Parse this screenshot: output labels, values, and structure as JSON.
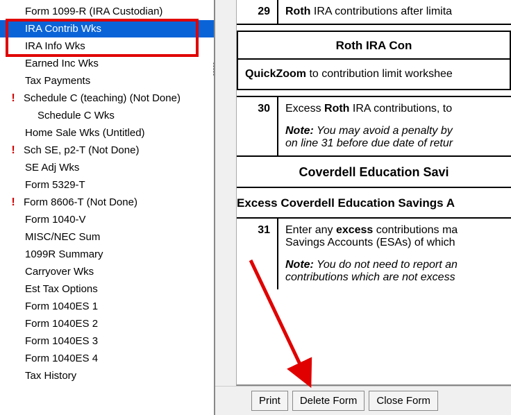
{
  "sidebar": {
    "items": [
      {
        "label": "Form 1099-R (IRA Custodian)",
        "indent": 1,
        "flag": false,
        "selected": false
      },
      {
        "label": "IRA Contrib Wks",
        "indent": 1,
        "flag": false,
        "selected": true
      },
      {
        "label": "IRA Info Wks",
        "indent": 1,
        "flag": false,
        "selected": false
      },
      {
        "label": "Earned Inc Wks",
        "indent": 1,
        "flag": false,
        "selected": false
      },
      {
        "label": "Tax Payments",
        "indent": 1,
        "flag": false,
        "selected": false
      },
      {
        "label": "Schedule C (teaching) (Not Done)",
        "indent": 1,
        "flag": true,
        "selected": false
      },
      {
        "label": "Schedule C Wks",
        "indent": 2,
        "flag": false,
        "selected": false
      },
      {
        "label": "Home Sale Wks (Untitled)",
        "indent": 1,
        "flag": false,
        "selected": false
      },
      {
        "label": "Sch SE, p2-T (Not Done)",
        "indent": 1,
        "flag": true,
        "selected": false
      },
      {
        "label": "SE Adj Wks",
        "indent": 1,
        "flag": false,
        "selected": false
      },
      {
        "label": "Form 5329-T",
        "indent": 1,
        "flag": false,
        "selected": false
      },
      {
        "label": "Form 8606-T (Not Done)",
        "indent": 1,
        "flag": true,
        "selected": false
      },
      {
        "label": "Form 1040-V",
        "indent": 1,
        "flag": false,
        "selected": false
      },
      {
        "label": "MISC/NEC Sum",
        "indent": 1,
        "flag": false,
        "selected": false
      },
      {
        "label": "1099R Summary",
        "indent": 1,
        "flag": false,
        "selected": false
      },
      {
        "label": "Carryover Wks",
        "indent": 1,
        "flag": false,
        "selected": false
      },
      {
        "label": "Est Tax Options",
        "indent": 1,
        "flag": false,
        "selected": false
      },
      {
        "label": "Form 1040ES 1",
        "indent": 1,
        "flag": false,
        "selected": false
      },
      {
        "label": "Form 1040ES 2",
        "indent": 1,
        "flag": false,
        "selected": false
      },
      {
        "label": "Form 1040ES 3",
        "indent": 1,
        "flag": false,
        "selected": false
      },
      {
        "label": "Form 1040ES 4",
        "indent": 1,
        "flag": false,
        "selected": false
      },
      {
        "label": "Tax History",
        "indent": 1,
        "flag": false,
        "selected": false
      }
    ]
  },
  "form": {
    "line29_num": "29",
    "line29_prefix_bold": "Roth",
    "line29_rest": " IRA contributions after limita",
    "inset_heading": "Roth IRA Con",
    "inset_body_bold": "QuickZoom",
    "inset_body_rest": " to contribution limit workshee",
    "line30_num": "30",
    "line30_text1_a": "Excess ",
    "line30_text1_bold": "Roth",
    "line30_text1_b": " IRA contributions, to",
    "line30_note_label": "Note:",
    "line30_note_a": " You may avoid a penalty by",
    "line30_note_b": " on line 31 before due date of retur",
    "section_heading": "Coverdell Education Savi",
    "sub_heading": "Excess Coverdell Education Savings A",
    "line31_num": "31",
    "line31_text1_a": "Enter any ",
    "line31_text1_bold": "excess",
    "line31_text1_b": " contributions ma",
    "line31_text2": "Savings Accounts (ESAs) of which",
    "line31_note_label": "Note:",
    "line31_note_a": " You do not need to report an",
    "line31_note_b": " contributions which are not excess"
  },
  "buttons": {
    "print": "Print",
    "delete": "Delete Form",
    "close": "Close Form"
  }
}
